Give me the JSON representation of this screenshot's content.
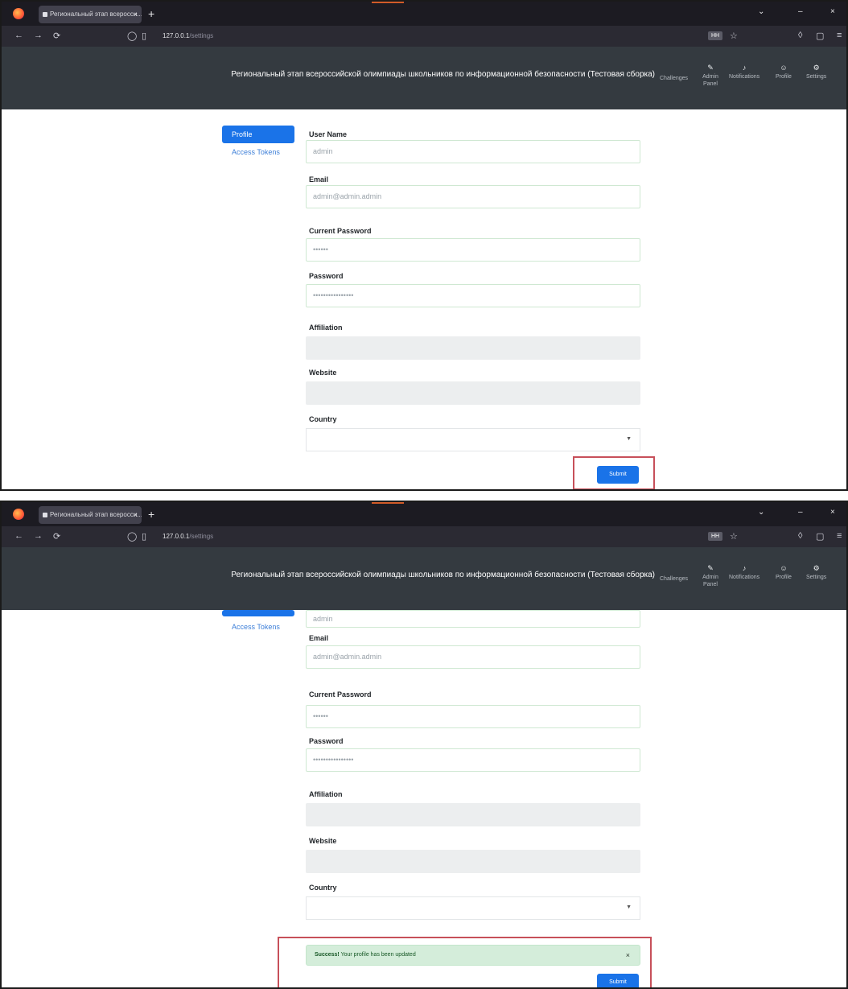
{
  "browser": {
    "tab_title": "Региональный этап всеросси...",
    "tab_close": "×",
    "new_tab": "+",
    "url_host": "127.0.0.1",
    "url_path": "/settings",
    "badge": "HH",
    "window_controls": [
      "⌄",
      "–",
      "×"
    ]
  },
  "site": {
    "title_1": "Региональный этап всероссийской олимпиады школьников по информационной безопасности (Тестовая сборка)",
    "title_2": "Региональный этап всероссийской олимпиады школьников по информационной безопасности (Тестовая сборка)",
    "nav": [
      {
        "label": "Challenges",
        "icon": ""
      },
      {
        "label": "Admin Panel",
        "icon": "✎"
      },
      {
        "label": "Notifications",
        "icon": "♪"
      },
      {
        "label": "Profile",
        "icon": "☺"
      },
      {
        "label": "Settings",
        "icon": "⚙"
      }
    ]
  },
  "sidebar": {
    "profile": "Profile",
    "access_tokens": "Access Tokens"
  },
  "form": {
    "username_label": "User Name",
    "username_value": "admin",
    "email_label": "Email",
    "email_value": "admin@admin.admin",
    "current_password_label": "Current Password",
    "current_password_value": "••••••",
    "password_label": "Password",
    "password_value": "••••••••••••••••",
    "affiliation_label": "Affiliation",
    "website_label": "Website",
    "country_label": "Country",
    "country_caret": "▼",
    "submit_label": "Submit"
  },
  "alert": {
    "strong": "Success!",
    "text": " Your profile has been updated",
    "close": "×"
  },
  "colors": {
    "primary": "#1a73e8",
    "header": "#343a40",
    "highlight": "#c7505a",
    "success_bg": "#d4edda"
  }
}
